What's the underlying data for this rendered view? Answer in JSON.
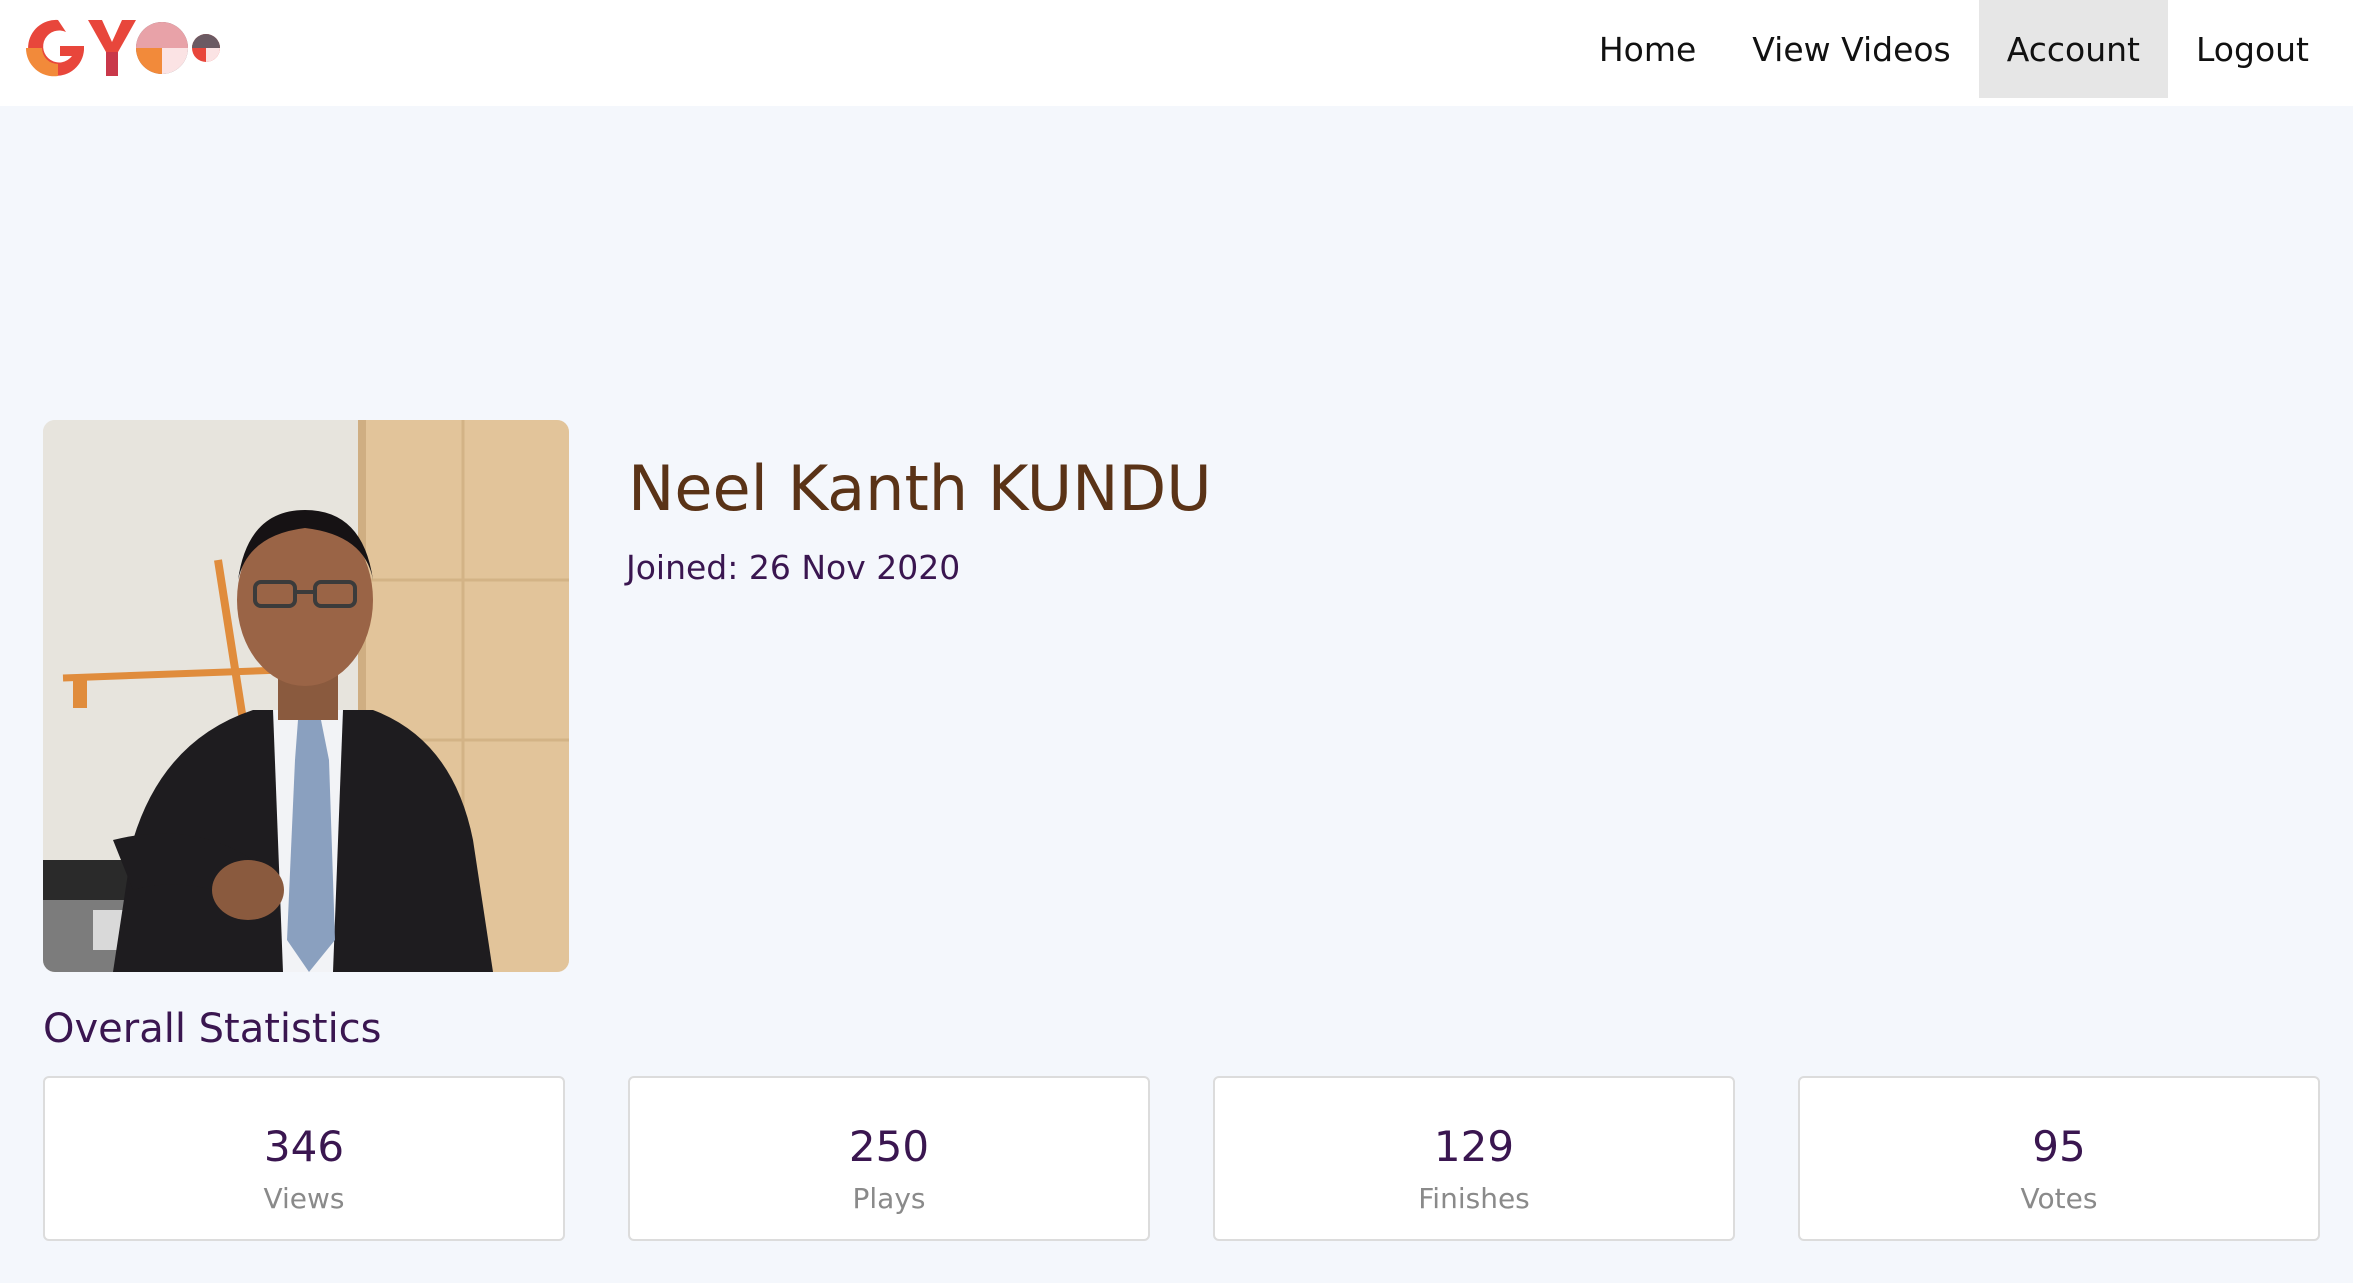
{
  "header": {
    "logo_text": "GYOO",
    "nav": [
      {
        "label": "Home",
        "active": false
      },
      {
        "label": "View Videos",
        "active": false
      },
      {
        "label": "Account",
        "active": true
      },
      {
        "label": "Logout",
        "active": false
      }
    ]
  },
  "profile": {
    "name": "Neel Kanth KUNDU",
    "joined_label": "Joined:",
    "joined_date": "26 Nov 2020"
  },
  "stats": {
    "heading": "Overall Statistics",
    "items": [
      {
        "value": "346",
        "label": "Views"
      },
      {
        "value": "250",
        "label": "Plays"
      },
      {
        "value": "129",
        "label": "Finishes"
      },
      {
        "value": "95",
        "label": "Votes"
      }
    ]
  },
  "colors": {
    "page_background": "#f4f7fc",
    "name_color": "#5a3317",
    "accent_purple": "#3a1650",
    "active_nav_bg": "#e6e6e6"
  }
}
